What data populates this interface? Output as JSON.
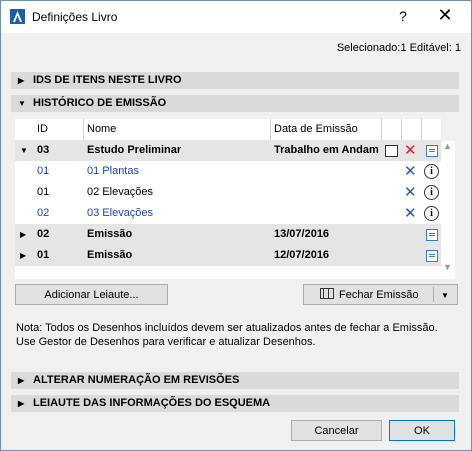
{
  "window": {
    "title": "Definições Livro",
    "help_label": "?",
    "close_label": "✕"
  },
  "selection_info": "Selecionado:1 Editável: 1",
  "sections": {
    "ids": "IDS DE ITENS NESTE LIVRO",
    "history": "HISTÓRICO DE EMISSÃO",
    "renumber": "ALTERAR NUMERAÇÃO EM REVISÕES",
    "layout_info": "LEIAUTE DAS INFORMAÇÕES DO ESQUEMA"
  },
  "table": {
    "headers": {
      "id": "ID",
      "name": "Nome",
      "date": "Data de Emissão"
    },
    "rows": [
      {
        "id": "03",
        "name": "Estudo Preliminar",
        "date": "Trabalho em Andamento"
      },
      {
        "id": "01",
        "name": "01 Plantas",
        "date": ""
      },
      {
        "id": "01",
        "name": "02 Elevações",
        "date": ""
      },
      {
        "id": "02",
        "name": "03 Elevações",
        "date": ""
      },
      {
        "id": "02",
        "name": "Emissão",
        "date": "13/07/2016"
      },
      {
        "id": "01",
        "name": "Emissão",
        "date": "12/07/2016"
      }
    ]
  },
  "buttons": {
    "add_layout": "Adicionar Leiaute...",
    "close_issue": "Fechar Emissão",
    "cancel": "Cancelar",
    "ok": "OK"
  },
  "note": {
    "line1": "Nota: Todos os Desenhos incluídos devem ser atualizados antes de fechar a Emissão.",
    "line2": "Use Gestor de Desenhos para verificar e atualizar Desenhos."
  },
  "colors": {
    "link": "#1f43b5",
    "delete_blue": "#1a5fb4",
    "delete_red": "#d6262b",
    "accent": "#0078d7"
  }
}
